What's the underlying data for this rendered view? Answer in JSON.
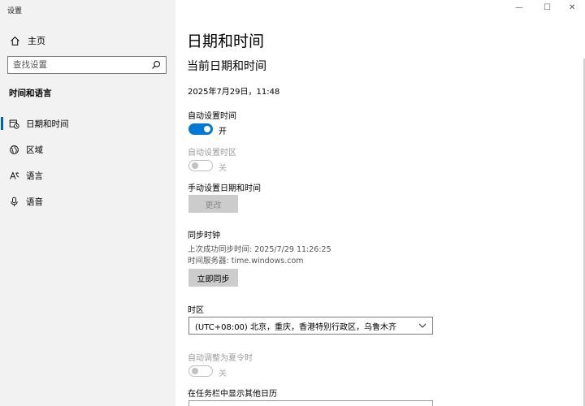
{
  "window": {
    "title": "设置",
    "controls": {
      "minimize": "—",
      "maximize": "☐",
      "close": "✕"
    }
  },
  "sidebar": {
    "home_label": "主页",
    "search_placeholder": "查找设置",
    "section_title": "时间和语言",
    "items": [
      {
        "label": "日期和时间",
        "icon": "calendar-clock-icon",
        "selected": true
      },
      {
        "label": "区域",
        "icon": "globe-icon",
        "selected": false
      },
      {
        "label": "语言",
        "icon": "language-icon",
        "selected": false
      },
      {
        "label": "语音",
        "icon": "microphone-icon",
        "selected": false
      }
    ]
  },
  "main": {
    "title": "日期和时间",
    "subtitle": "当前日期和时间",
    "current_datetime": "2025年7月29日，11:48",
    "auto_time": {
      "label": "自动设置时间",
      "state_label": "开",
      "on": true
    },
    "auto_timezone": {
      "label": "自动设置时区",
      "state_label": "关",
      "on": false,
      "disabled": true
    },
    "manual": {
      "label": "手动设置日期和时间",
      "button_label": "更改",
      "disabled": true
    },
    "sync": {
      "label": "同步时钟",
      "last_sync": "上次成功同步时间: 2025/7/29 11:26:25",
      "server": "时间服务器: time.windows.com",
      "button_label": "立即同步"
    },
    "timezone": {
      "label": "时区",
      "value": "(UTC+08:00) 北京，重庆，香港特别行政区，乌鲁木齐"
    },
    "dst": {
      "label": "自动调整为夏令时",
      "state_label": "关",
      "on": false,
      "disabled": true
    },
    "extra_calendar": {
      "label": "在任务栏中显示其他日历"
    }
  },
  "colors": {
    "accent": "#0078d7",
    "sidebar_bg": "#f2f2f2",
    "button_bg": "#cccccc"
  }
}
